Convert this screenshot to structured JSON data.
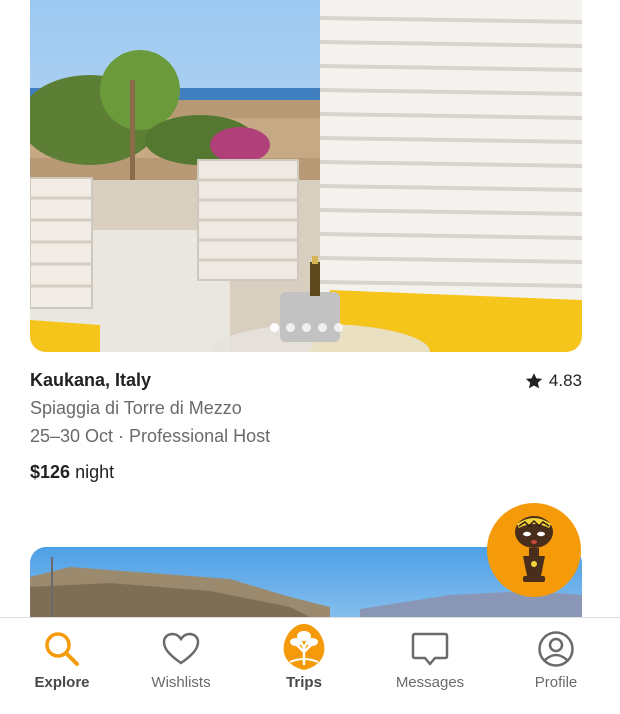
{
  "listing": {
    "location": "Kaukana, Italy",
    "rating": "4.83",
    "subtitle": "Spiaggia di Torre di Mezzo",
    "dates": "25–30 Oct · Professional Host",
    "price": "$126",
    "price_unit": "night",
    "photo_count_dots": 5,
    "active_photo": 1
  },
  "tabs": [
    {
      "label": "Explore",
      "icon": "search-icon"
    },
    {
      "label": "Wishlists",
      "icon": "heart-icon"
    },
    {
      "label": "Trips",
      "icon": "tree-logo-icon"
    },
    {
      "label": "Messages",
      "icon": "message-icon"
    },
    {
      "label": "Profile",
      "icon": "profile-icon"
    }
  ],
  "colors": {
    "accent": "#f59a09",
    "text_primary": "#222222",
    "text_secondary": "#6a6a6a",
    "tab_inactive": "#6a6a6a"
  }
}
